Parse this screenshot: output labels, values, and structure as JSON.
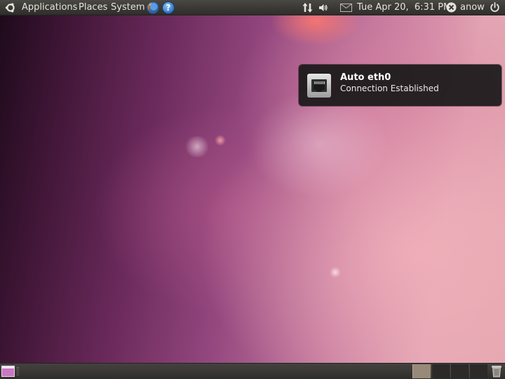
{
  "top_panel": {
    "menus": {
      "applications": "Applications",
      "places": "Places",
      "system": "System"
    },
    "launchers": {
      "firefox": "firefox-icon",
      "help": "?"
    },
    "indicators": {
      "network": "network-transfer-icon",
      "volume": "volume-icon",
      "mail": "mail-icon"
    },
    "clock": "Tue Apr 20,  6:31 PM",
    "user": "anow",
    "session": "power-icon"
  },
  "notification": {
    "title": "Auto eth0",
    "body": "Connection Established",
    "icon": "ethernet-port-icon"
  },
  "bottom_panel": {
    "show_desktop": "show-desktop-icon",
    "workspaces": [
      "workspace-1",
      "workspace-2",
      "workspace-3",
      "workspace-4"
    ],
    "active_workspace": 1,
    "trash": "trash-icon"
  },
  "colors": {
    "panel": "#3b3a36",
    "panel_text": "#e6e3dc",
    "notification_bg": "#181818",
    "active_workspace": "#988a79",
    "wallpaper_accent": "#e4a7b5"
  }
}
